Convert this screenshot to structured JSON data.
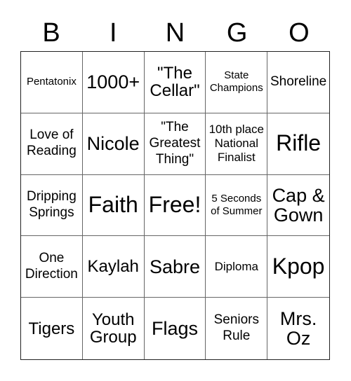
{
  "header": {
    "letters": [
      "B",
      "I",
      "N",
      "G",
      "O"
    ]
  },
  "board": {
    "cells": [
      "Pentatonix",
      "1000+",
      "\"The Cellar\"",
      "State Champions",
      "Shoreline",
      "Love of Reading",
      "Nicole",
      "\"The Greatest Thing\"",
      "10th place National Finalist",
      "Rifle",
      "Dripping Springs",
      "Faith",
      "Free!",
      "5 Seconds of Summer",
      "Cap & Gown",
      "One Direction",
      "Kaylah",
      "Sabre",
      "Diploma",
      "Kpop",
      "Tigers",
      "Youth Group",
      "Flags",
      "Seniors Rule",
      "Mrs. Oz"
    ]
  }
}
